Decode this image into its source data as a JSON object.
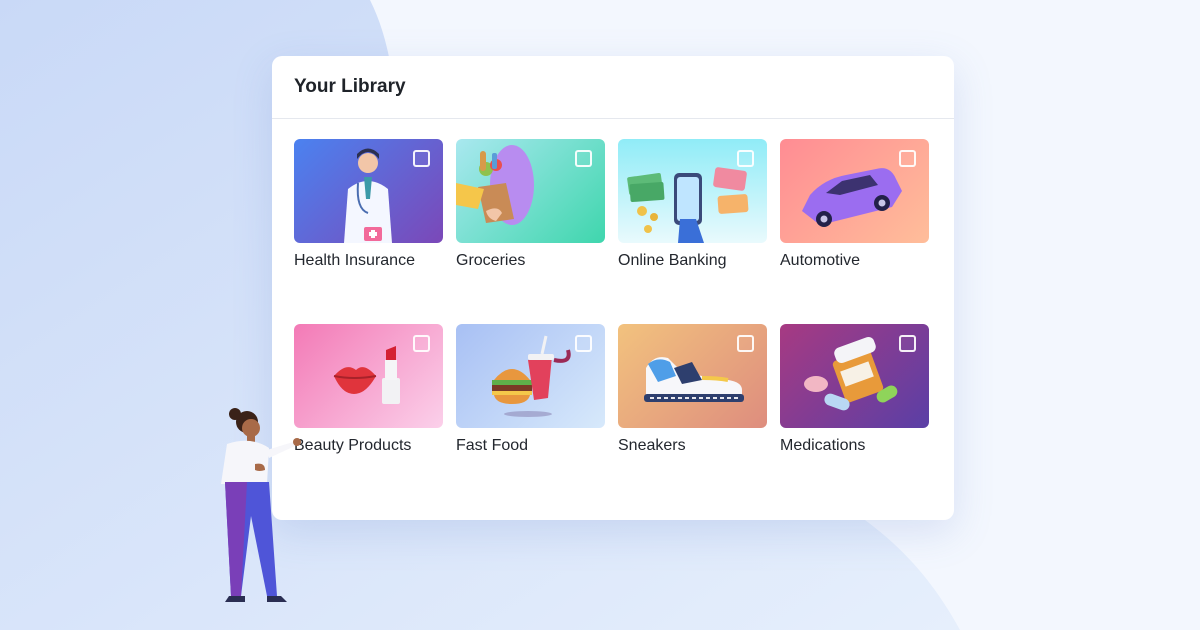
{
  "library": {
    "title": "Your Library",
    "categories": [
      {
        "label": "Health Insurance",
        "icon": "doctor-icon",
        "checked": false,
        "gradient": [
          "#4b82f0",
          "#7b48b8"
        ]
      },
      {
        "label": "Groceries",
        "icon": "grocery-bag-icon",
        "checked": false,
        "gradient": [
          "#a9e8ef",
          "#3fd6ad"
        ]
      },
      {
        "label": "Online Banking",
        "icon": "phone-cash-icon",
        "checked": false,
        "gradient": [
          "#90ecf7",
          "#e9fafd"
        ]
      },
      {
        "label": "Automotive",
        "icon": "car-icon",
        "checked": false,
        "gradient": [
          "#ff8c93",
          "#ffbe9a"
        ]
      },
      {
        "label": "Beauty Products",
        "icon": "lipstick-icon",
        "checked": false,
        "gradient": [
          "#f37ab6",
          "#fbd0ea"
        ]
      },
      {
        "label": "Fast Food",
        "icon": "burger-drink-icon",
        "checked": false,
        "gradient": [
          "#a8c0f4",
          "#d7e9fb"
        ]
      },
      {
        "label": "Sneakers",
        "icon": "sneaker-icon",
        "checked": false,
        "gradient": [
          "#f2c27e",
          "#de8d7e"
        ]
      },
      {
        "label": "Medications",
        "icon": "pill-bottle-icon",
        "checked": false,
        "gradient": [
          "#a73a82",
          "#5a3fa6"
        ]
      }
    ]
  }
}
